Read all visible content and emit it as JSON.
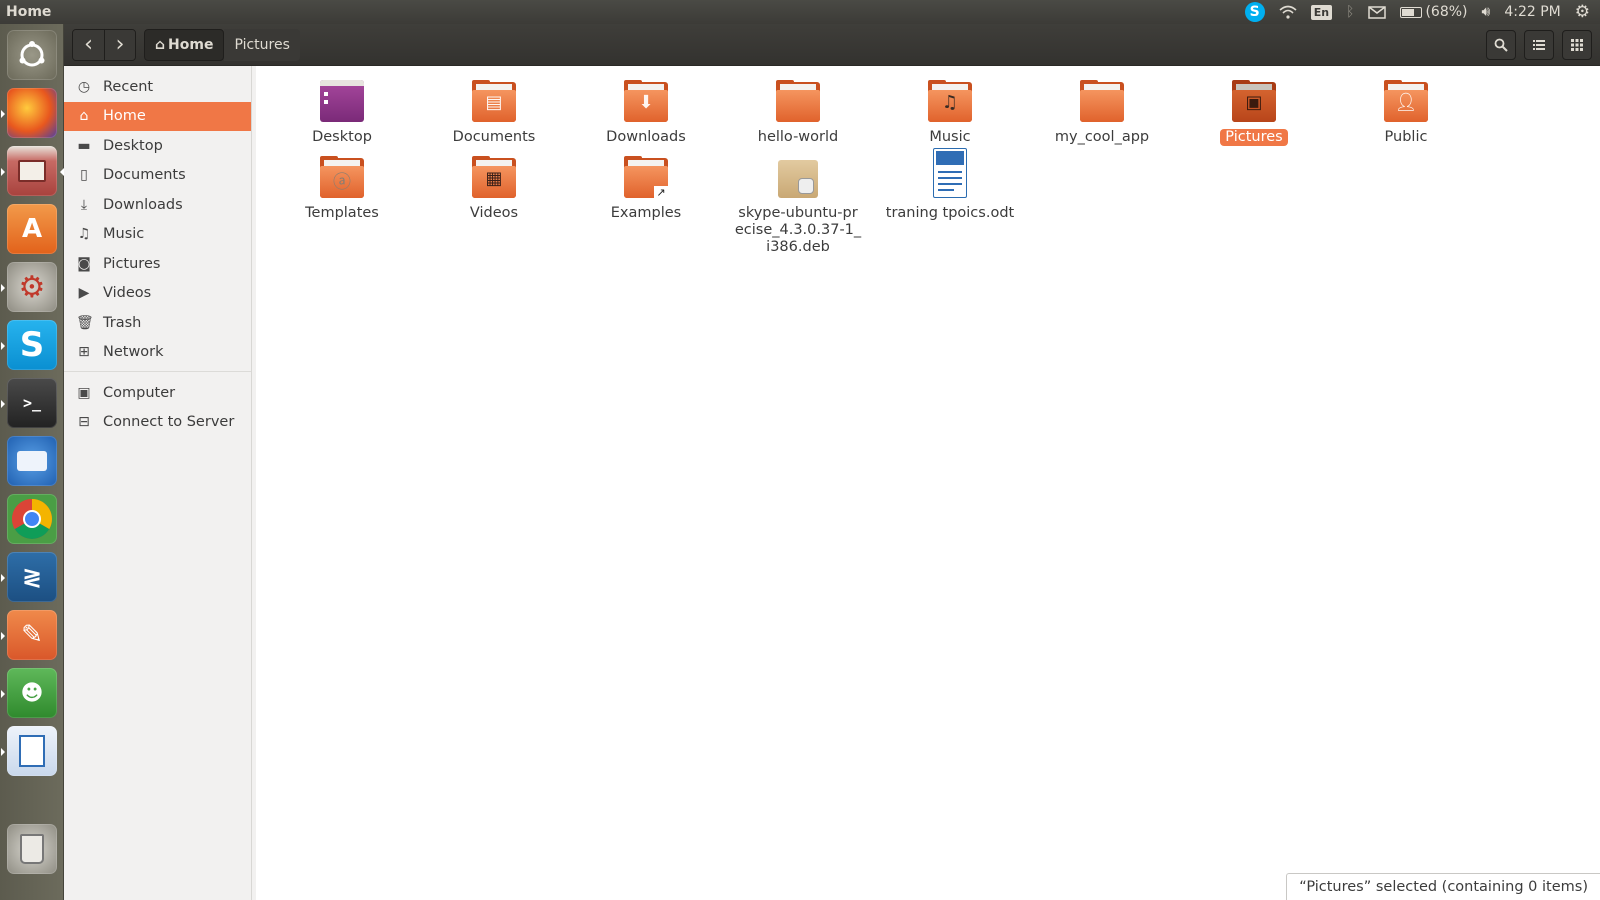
{
  "topbar": {
    "title": "Home",
    "keyboard_layout": "En",
    "battery": "(68%)",
    "battery_level": 0.68,
    "time": "4:22 PM"
  },
  "header": {
    "back_glyph": "‹",
    "forward_glyph": "›",
    "breadcrumbs": [
      {
        "label": "Home"
      },
      {
        "label": "Pictures"
      }
    ]
  },
  "sidebar": {
    "places": [
      {
        "label": "Recent",
        "icon": "clock-icon"
      },
      {
        "label": "Home",
        "icon": "home-icon"
      },
      {
        "label": "Desktop",
        "icon": "folder-icon"
      },
      {
        "label": "Documents",
        "icon": "document-icon"
      },
      {
        "label": "Downloads",
        "icon": "download-icon"
      },
      {
        "label": "Music",
        "icon": "music-icon"
      },
      {
        "label": "Pictures",
        "icon": "camera-icon"
      },
      {
        "label": "Videos",
        "icon": "film-icon"
      },
      {
        "label": "Trash",
        "icon": "trash-icon"
      },
      {
        "label": "Network",
        "icon": "network-icon"
      }
    ],
    "devices": [
      {
        "label": "Computer",
        "icon": "computer-icon"
      },
      {
        "label": "Connect to Server",
        "icon": "server-icon"
      }
    ]
  },
  "files": [
    {
      "label": "Desktop"
    },
    {
      "label": "Documents"
    },
    {
      "label": "Downloads"
    },
    {
      "label": "hello-world"
    },
    {
      "label": "Music"
    },
    {
      "label": "my_cool_app"
    },
    {
      "label": "Pictures"
    },
    {
      "label": "Public"
    },
    {
      "label": "Templates"
    },
    {
      "label": "Videos"
    },
    {
      "label": "Examples"
    },
    {
      "label": "skype-ubuntu-precise_4.3.0.37-1_i386.deb"
    },
    {
      "label": "traning tpoics.odt"
    }
  ],
  "status": {
    "text": "“Pictures” selected  (containing 0 items)"
  },
  "colors": {
    "accent": "#f07746",
    "folder_orange": "#e0622c",
    "topbar_bg": "#3c3b37"
  }
}
